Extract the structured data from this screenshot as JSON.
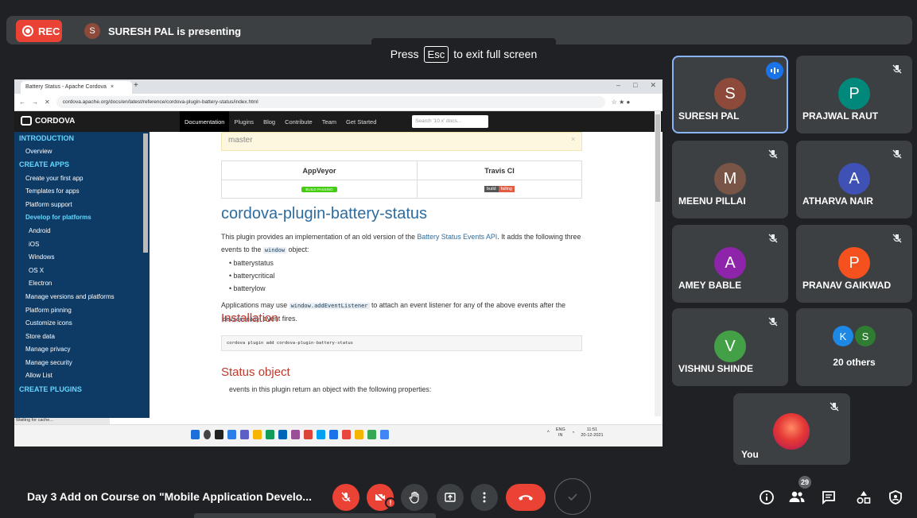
{
  "recording": {
    "label": "REC"
  },
  "presenter": {
    "initial": "S",
    "text": "SURESH PAL is presenting"
  },
  "fullscreen_tip": {
    "before": "Press",
    "key": "Esc",
    "after": "to exit full screen"
  },
  "shared_screen": {
    "browser": {
      "tab_title": "Battery Status - Apache Cordova",
      "tab_close": "×",
      "new_tab": "+",
      "url": "cordova.apache.org/docs/en/latest/reference/cordova-plugin-battery-status/index.html"
    },
    "site": {
      "logo": "CORDOVA",
      "nav": [
        "Documentation",
        "Plugins",
        "Blog",
        "Contribute",
        "Team",
        "Get Started"
      ],
      "search_placeholder": "Search '10.x' docs...",
      "sidebar": [
        {
          "label": "INTRODUCTION",
          "kind": "head"
        },
        {
          "label": "Overview",
          "kind": "item"
        },
        {
          "label": "CREATE APPS",
          "kind": "head"
        },
        {
          "label": "Create your first app",
          "kind": "item"
        },
        {
          "label": "Templates for apps",
          "kind": "item"
        },
        {
          "label": "Platform support",
          "kind": "item"
        },
        {
          "label": "Develop for platforms",
          "kind": "sel"
        },
        {
          "label": "Android",
          "kind": "sub"
        },
        {
          "label": "iOS",
          "kind": "sub"
        },
        {
          "label": "Windows",
          "kind": "sub"
        },
        {
          "label": "OS X",
          "kind": "sub"
        },
        {
          "label": "Electron",
          "kind": "sub"
        },
        {
          "label": "Manage versions and platforms",
          "kind": "item"
        },
        {
          "label": "Platform pinning",
          "kind": "item"
        },
        {
          "label": "Customize icons",
          "kind": "item"
        },
        {
          "label": "Store data",
          "kind": "item"
        },
        {
          "label": "Manage privacy",
          "kind": "item"
        },
        {
          "label": "Manage security",
          "kind": "item"
        },
        {
          "label": "Allow List",
          "kind": "item"
        },
        {
          "label": "CREATE PLUGINS",
          "kind": "head"
        }
      ],
      "status_text": "Waiting for cache...",
      "branch_notice": "master",
      "ci": {
        "col1": "AppVeyor",
        "col2": "Travis CI",
        "badge_pass": "BUILD PASSING",
        "badge_fail_left": "build",
        "badge_fail_right": "failing"
      },
      "title": "cordova-plugin-battery-status",
      "intro_1": "This plugin provides an implementation of an old version of the",
      "intro_link": "Battery Status Events API",
      "intro_2": ". It adds the following three events to the",
      "intro_code": "window",
      "intro_3": "object:",
      "events": [
        "batterystatus",
        "batterycritical",
        "batterylow"
      ],
      "usage_1": "Applications may use",
      "usage_code": "window.addEventListener",
      "usage_2": "to attach an event listener for any of the above events after the",
      "usage_code2": "deviceready",
      "usage_3": "event fires.",
      "install_heading": "Installation",
      "install_cmd": "cordova plugin add cordova-plugin-battery-status",
      "status_heading": "Status object",
      "status_para": "events in this plugin return an object with the following properties:"
    },
    "taskbar": {
      "lang": "ENG",
      "region": "IN",
      "time": "11:51",
      "date": "20-12-2021"
    }
  },
  "participants": [
    {
      "initial": "S",
      "name": "SURESH PAL",
      "color": "#8d4a3b"
    },
    {
      "initial": "P",
      "name": "PRAJWAL RAUT",
      "color": "#00897b"
    },
    {
      "initial": "M",
      "name": "MEENU PILLAI",
      "color": "#795548"
    },
    {
      "initial": "A",
      "name": "ATHARVA NAIR",
      "color": "#3f51b5"
    },
    {
      "initial": "A",
      "name": "AMEY BABLE",
      "color": "#8e24aa"
    },
    {
      "initial": "P",
      "name": "PRANAV GAIKWAD",
      "color": "#f4511e"
    },
    {
      "initial": "V",
      "name": "VISHNU SHINDE",
      "color": "#43a047"
    }
  ],
  "others": {
    "initials": [
      "K",
      "S"
    ],
    "colors": [
      "#1e88e5",
      "#2e7d32"
    ],
    "label": "20 others"
  },
  "self_tile": {
    "name": "You"
  },
  "meeting": {
    "title": "Day 3 Add on Course on \"Mobile Application Develo..."
  },
  "people_count": "29",
  "icons": {
    "mic_off": "mic-off-icon",
    "cam_off": "camera-off-icon",
    "hand": "raise-hand-icon",
    "present": "present-icon",
    "more": "more-options-icon",
    "hang_up": "end-call-icon",
    "info": "info-icon",
    "people": "people-icon",
    "chat": "chat-icon",
    "activities": "activities-icon",
    "host": "host-controls-icon"
  }
}
